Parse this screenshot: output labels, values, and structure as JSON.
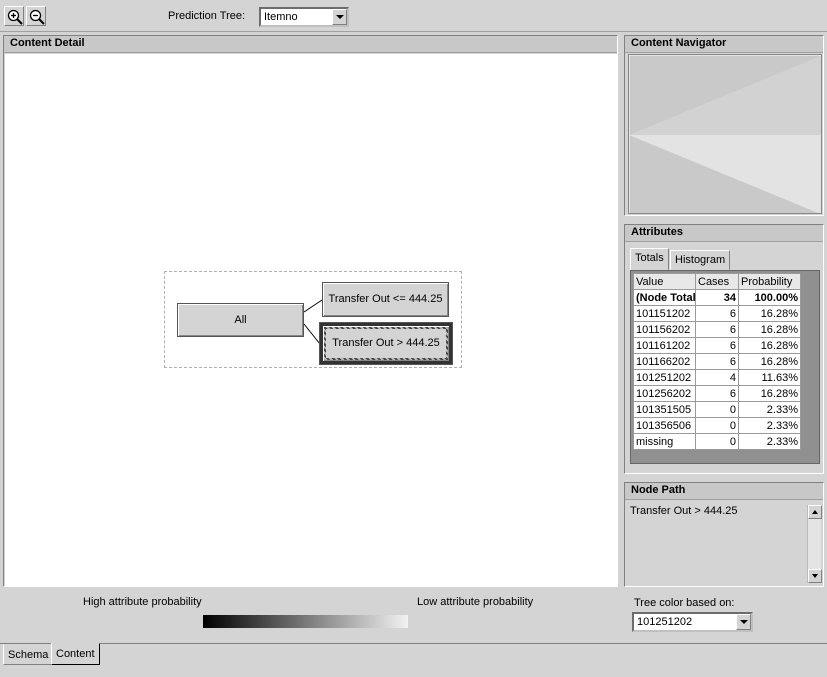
{
  "toolbar": {
    "zoom_in_icon": "zoom-in-icon",
    "zoom_out_icon": "zoom-out-icon",
    "prediction_tree_label": "Prediction Tree:",
    "prediction_tree_value": "Itemno"
  },
  "content_detail": {
    "title": "Content Detail",
    "nodes": {
      "root": "All",
      "left_branch": "Transfer Out <= 444.25",
      "right_branch": "Transfer Out > 444.25"
    }
  },
  "navigator": {
    "title": "Content Navigator"
  },
  "attributes": {
    "title": "Attributes",
    "tabs": [
      "Totals",
      "Histogram"
    ],
    "columns": [
      "Value",
      "Cases",
      "Probability"
    ],
    "rows": [
      [
        "(Node Total)",
        "34",
        "100.00%"
      ],
      [
        "101151202",
        "6",
        "16.28%"
      ],
      [
        "101156202",
        "6",
        "16.28%"
      ],
      [
        "101161202",
        "6",
        "16.28%"
      ],
      [
        "101166202",
        "6",
        "16.28%"
      ],
      [
        "101251202",
        "4",
        "11.63%"
      ],
      [
        "101256202",
        "6",
        "16.28%"
      ],
      [
        "101351505",
        "0",
        "2.33%"
      ],
      [
        "101356506",
        "0",
        "2.33%"
      ],
      [
        "missing",
        "0",
        "2.33%"
      ]
    ]
  },
  "node_path": {
    "title": "Node Path",
    "value": "Transfer Out > 444.25"
  },
  "legend": {
    "high": "High attribute probability",
    "low": "Low attribute probability",
    "tree_color_label": "Tree color based on:",
    "tree_color_value": "101251202"
  },
  "bottom_tabs": [
    "Schema",
    "Content"
  ],
  "colors": {
    "panel": "#d4d4d4",
    "canvas": "#ffffff",
    "title_bar": "#c8c8c8"
  }
}
